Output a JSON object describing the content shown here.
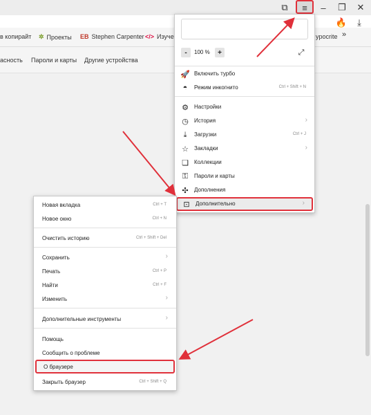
{
  "bookmarks": [
    {
      "label": "в копирайт",
      "icon": ""
    },
    {
      "label": "Проекты",
      "icon": "✲"
    },
    {
      "label": "Stephen Carpenter",
      "icon": "EB"
    },
    {
      "label": "Изучен",
      "icon": "</>"
    },
    {
      "label": "ypocrite",
      "icon": ""
    }
  ],
  "bookmarks_more": "»",
  "settings_tabs": [
    "асность",
    "Пароли и карты",
    "Другие устройства"
  ],
  "menu": {
    "zoom_minus": "-",
    "zoom_value": "100 %",
    "zoom_plus": "+",
    "items": [
      {
        "label": "Включить турбо",
        "shortcut": "",
        "icon": "turbo-icon"
      },
      {
        "label": "Режим инкогнито",
        "shortcut": "Ctrl + Shift + N",
        "icon": "incognito-icon"
      },
      {
        "label": "Настройки",
        "shortcut": "",
        "icon": "gear-icon"
      },
      {
        "label": "История",
        "shortcut": "",
        "icon": "clock-icon",
        "arrow": true
      },
      {
        "label": "Загрузки",
        "shortcut": "Ctrl + J",
        "icon": "download-icon"
      },
      {
        "label": "Закладки",
        "shortcut": "",
        "icon": "star-icon",
        "arrow": true
      },
      {
        "label": "Коллекции",
        "shortcut": "",
        "icon": "collections-icon"
      },
      {
        "label": "Пароли и карты",
        "shortcut": "",
        "icon": "key-icon"
      },
      {
        "label": "Дополнения",
        "shortcut": "",
        "icon": "puzzle-icon"
      },
      {
        "label": "Дополнительно",
        "shortcut": "",
        "icon": "more-icon",
        "arrow": true
      }
    ]
  },
  "submenu": {
    "items": [
      {
        "label": "Новая вкладка",
        "shortcut": "Ctrl + T"
      },
      {
        "label": "Новое окно",
        "shortcut": "Ctrl + N"
      },
      {
        "label": "Очистить историю",
        "shortcut": "Ctrl + Shift + Del"
      },
      {
        "label": "Сохранить",
        "shortcut": ""
      },
      {
        "label": "Печать",
        "shortcut": "Ctrl + P"
      },
      {
        "label": "Найти",
        "shortcut": "Ctrl + F"
      },
      {
        "label": "Изменить",
        "shortcut": ""
      },
      {
        "label": "Дополнительные инструменты",
        "shortcut": ""
      },
      {
        "label": "Помощь",
        "shortcut": ""
      },
      {
        "label": "Сообщить о проблеме",
        "shortcut": ""
      },
      {
        "label": "О браузере",
        "shortcut": ""
      },
      {
        "label": "Закрыть браузер",
        "shortcut": "Ctrl + Shift + Q"
      }
    ]
  },
  "colors": {
    "highlight_border": "#e0303a",
    "arrow": "#e0303a"
  }
}
